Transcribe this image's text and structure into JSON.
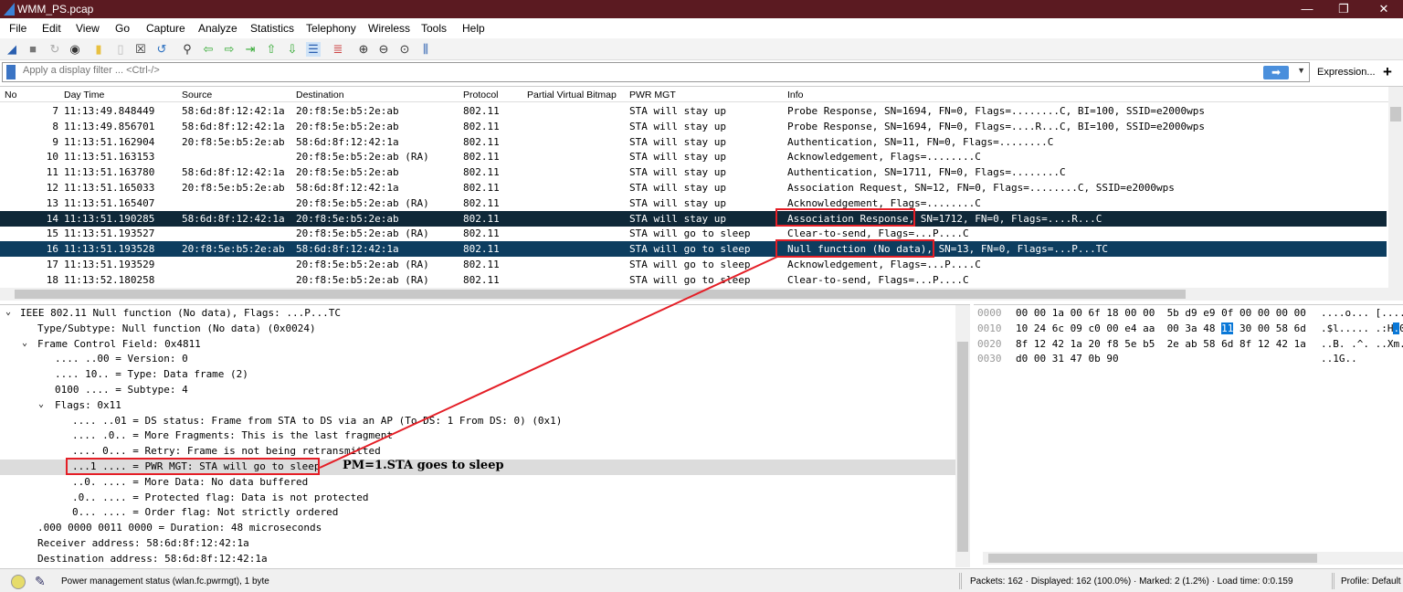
{
  "window": {
    "title": "WMM_PS.pcap",
    "min": "—",
    "max": "❐",
    "close": "✕"
  },
  "menu": [
    "File",
    "Edit",
    "View",
    "Go",
    "Capture",
    "Analyze",
    "Statistics",
    "Telephony",
    "Wireless",
    "Tools",
    "Help"
  ],
  "toolbar_icons": [
    "shark-fin-start-icon",
    "stop-icon",
    "restart-icon",
    "options-icon",
    "open-icon",
    "file-icon",
    "close-file-icon",
    "reload-icon",
    "find-icon",
    "back-icon",
    "forward-icon",
    "goto-icon",
    "first-icon",
    "last-icon",
    "autoscroll-icon",
    "colorize-icon",
    "zoom-in-icon",
    "zoom-out-icon",
    "zoom-normal-icon",
    "resize-columns-icon"
  ],
  "filter": {
    "placeholder": "Apply a display filter ... <Ctrl-/>",
    "expression": "Expression...",
    "add": "+",
    "apply": "➡",
    "dropdown": "▼"
  },
  "packet_list": {
    "columns": [
      "No",
      "Day Time",
      "Source",
      "Destination",
      "Protocol",
      "Partial Virtual Bitmap",
      "PWR MGT",
      "Info"
    ],
    "rows": [
      [
        "7",
        "11:13:49.848449",
        "58:6d:8f:12:42:1a",
        "20:f8:5e:b5:2e:ab",
        "802.11",
        "",
        "STA will stay up",
        "Probe Response, SN=1694, FN=0, Flags=........C, BI=100, SSID=e2000wps"
      ],
      [
        "8",
        "11:13:49.856701",
        "58:6d:8f:12:42:1a",
        "20:f8:5e:b5:2e:ab",
        "802.11",
        "",
        "STA will stay up",
        "Probe Response, SN=1694, FN=0, Flags=....R...C, BI=100, SSID=e2000wps"
      ],
      [
        "9",
        "11:13:51.162904",
        "20:f8:5e:b5:2e:ab",
        "58:6d:8f:12:42:1a",
        "802.11",
        "",
        "STA will stay up",
        "Authentication, SN=11, FN=0, Flags=........C"
      ],
      [
        "10",
        "11:13:51.163153",
        "",
        "20:f8:5e:b5:2e:ab (RA)",
        "802.11",
        "",
        "STA will stay up",
        "Acknowledgement, Flags=........C"
      ],
      [
        "11",
        "11:13:51.163780",
        "58:6d:8f:12:42:1a",
        "20:f8:5e:b5:2e:ab",
        "802.11",
        "",
        "STA will stay up",
        "Authentication, SN=1711, FN=0, Flags=........C"
      ],
      [
        "12",
        "11:13:51.165033",
        "20:f8:5e:b5:2e:ab",
        "58:6d:8f:12:42:1a",
        "802.11",
        "",
        "STA will stay up",
        "Association Request, SN=12, FN=0, Flags=........C, SSID=e2000wps"
      ],
      [
        "13",
        "11:13:51.165407",
        "",
        "20:f8:5e:b5:2e:ab (RA)",
        "802.11",
        "",
        "STA will stay up",
        "Acknowledgement, Flags=........C"
      ],
      [
        "14",
        "11:13:51.190285",
        "58:6d:8f:12:42:1a",
        "20:f8:5e:b5:2e:ab",
        "802.11",
        "",
        "STA will stay up",
        "Association Response, SN=1712, FN=0, Flags=....R...C"
      ],
      [
        "15",
        "11:13:51.193527",
        "",
        "20:f8:5e:b5:2e:ab (RA)",
        "802.11",
        "",
        "STA will go to sleep",
        "Clear-to-send, Flags=...P....C"
      ],
      [
        "16",
        "11:13:51.193528",
        "20:f8:5e:b5:2e:ab",
        "58:6d:8f:12:42:1a",
        "802.11",
        "",
        "STA will go to sleep",
        "Null function (No data), SN=13, FN=0, Flags=...P...TC"
      ],
      [
        "17",
        "11:13:51.193529",
        "",
        "20:f8:5e:b5:2e:ab (RA)",
        "802.11",
        "",
        "STA will go to sleep",
        "Acknowledgement, Flags=...P....C"
      ],
      [
        "18",
        "11:13:52.180258",
        "",
        "20:f8:5e:b5:2e:ab (RA)",
        "802.11",
        "",
        "STA will go to sleep",
        "Clear-to-send, Flags=...P....C"
      ]
    ]
  },
  "details": [
    {
      "t": "IEEE 802.11 Null function (No data), Flags: ...P...TC",
      "i": 0,
      "e": "⌄"
    },
    {
      "t": "Type/Subtype: Null function (No data) (0x0024)",
      "i": 1
    },
    {
      "t": "Frame Control Field: 0x4811",
      "i": 1,
      "e": "⌄"
    },
    {
      "t": ".... ..00 = Version: 0",
      "i": 2
    },
    {
      "t": ".... 10.. = Type: Data frame (2)",
      "i": 2
    },
    {
      "t": "0100 .... = Subtype: 4",
      "i": 2
    },
    {
      "t": "Flags: 0x11",
      "i": 2,
      "e": "⌄"
    },
    {
      "t": ".... ..01 = DS status: Frame from STA to DS via an AP (To DS: 1 From DS: 0) (0x1)",
      "i": 3
    },
    {
      "t": ".... .0.. = More Fragments: This is the last fragment",
      "i": 3
    },
    {
      "t": ".... 0... = Retry: Frame is not being retransmitted",
      "i": 3
    },
    {
      "t": "...1 .... = PWR MGT: STA will go to sleep",
      "i": 3
    },
    {
      "t": "..0. .... = More Data: No data buffered",
      "i": 3
    },
    {
      "t": ".0.. .... = Protected flag: Data is not protected",
      "i": 3
    },
    {
      "t": "0... .... = Order flag: Not strictly ordered",
      "i": 3
    },
    {
      "t": ".000 0000 0011 0000 = Duration: 48 microseconds",
      "i": 1
    },
    {
      "t": "Receiver address: 58:6d:8f:12:42:1a",
      "i": 1
    },
    {
      "t": "Destination address: 58:6d:8f:12:42:1a",
      "i": 1
    }
  ],
  "hex": [
    {
      "o": "0000",
      "a": "00 00 1a 00 6f 18 00 00  5b d9 e9 0f 00 00 00 00",
      "s": "....o... [...."
    },
    {
      "o": "0010",
      "a": "10 24 6c 09 c0 00 e4 aa  00 3a 48 ",
      "h": "11",
      "b": " 30 00 58 6d",
      "s": ".$l..... .:H",
      "sh": ".",
      "ss": "0"
    },
    {
      "o": "0020",
      "a": "8f 12 42 1a 20 f8 5e b5  2e ab 58 6d 8f 12 42 1a",
      "s": "..B. .^. ..Xm."
    },
    {
      "o": "0030",
      "a": "d0 00 31 47 0b 90",
      "s": "..1G.."
    }
  ],
  "annotation": "PM=1.STA goes to sleep",
  "status": {
    "message": "Power management status (wlan.fc.pwrmgt), 1 byte",
    "packets": "Packets: 162 · Displayed: 162 (100.0%) · Marked: 2 (1.2%) · Load time: 0:0.159",
    "profile": "Profile: Default"
  }
}
